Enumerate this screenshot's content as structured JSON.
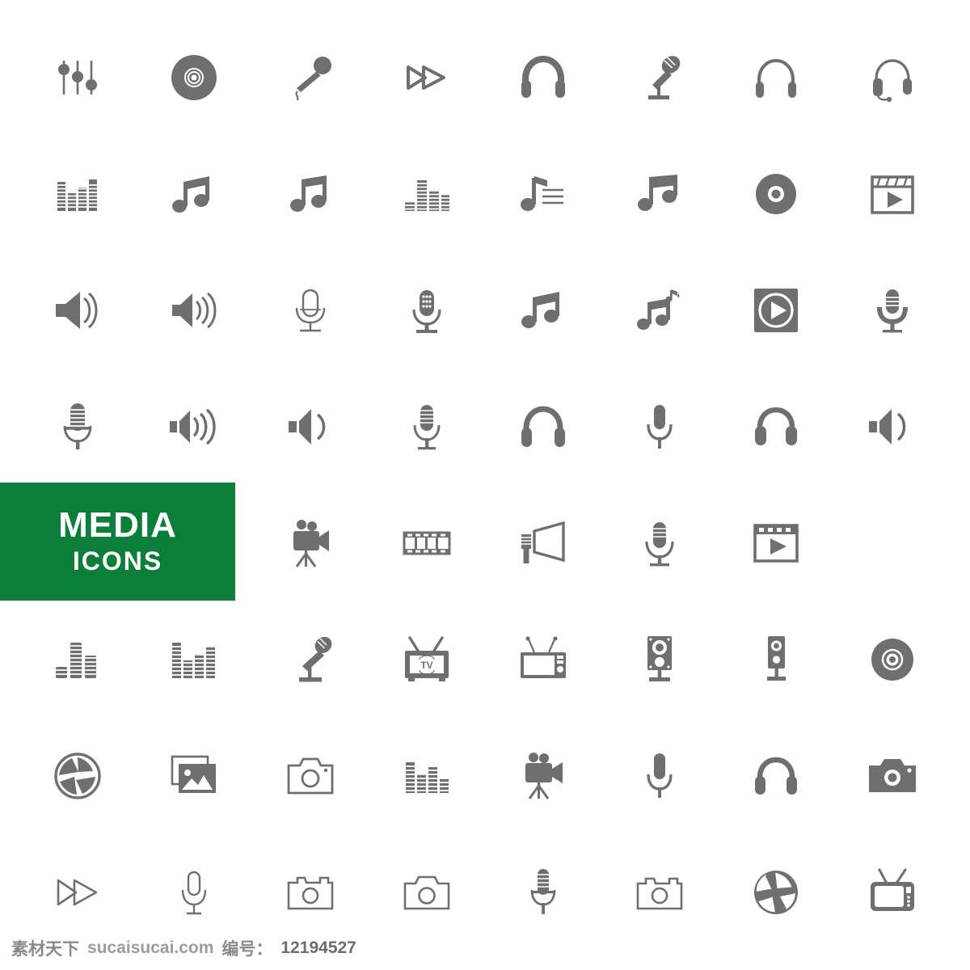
{
  "page": {
    "title": "Media Icons Set",
    "background_color": "#ffffff",
    "icon_color": "#6f6f6f",
    "accent_color": "#0b7e39",
    "columns": 8,
    "rows": 8
  },
  "banner": {
    "line1": "MEDIA",
    "line2": "ICONS",
    "background_color": "#0b7e39",
    "text_color": "#ffffff"
  },
  "footer": {
    "brand": "素材天下",
    "site": "sucaisucai.com",
    "id_label": "编号：",
    "id_value": "12194527"
  },
  "icons": [
    {
      "row": 1,
      "col": 1,
      "name": "equalizer-sliders-icon",
      "label": "Equalizer sliders"
    },
    {
      "row": 1,
      "col": 2,
      "name": "compact-disc-icon",
      "label": "Compact disc"
    },
    {
      "row": 1,
      "col": 3,
      "name": "handheld-microphone-icon",
      "label": "Handheld microphone"
    },
    {
      "row": 1,
      "col": 4,
      "name": "fast-forward-filled-icon",
      "label": "Fast forward"
    },
    {
      "row": 1,
      "col": 5,
      "name": "headphones-filled-icon",
      "label": "Headphones"
    },
    {
      "row": 1,
      "col": 6,
      "name": "studio-microphone-stand-icon",
      "label": "Studio microphone on stand"
    },
    {
      "row": 1,
      "col": 7,
      "name": "headphones-outline-icon",
      "label": "Headphones outline"
    },
    {
      "row": 1,
      "col": 8,
      "name": "headset-with-mic-icon",
      "label": "Headset with microphone"
    },
    {
      "row": 2,
      "col": 1,
      "name": "equalizer-bars-icon",
      "label": "Equalizer bars"
    },
    {
      "row": 2,
      "col": 2,
      "name": "music-note-beamed-icon",
      "label": "Beamed eighth notes"
    },
    {
      "row": 2,
      "col": 3,
      "name": "music-note-beamed-alt-icon",
      "label": "Beamed eighth notes alt"
    },
    {
      "row": 2,
      "col": 4,
      "name": "equalizer-levels-icon",
      "label": "Equalizer levels"
    },
    {
      "row": 2,
      "col": 5,
      "name": "music-playlist-icon",
      "label": "Music note with playlist"
    },
    {
      "row": 2,
      "col": 6,
      "name": "music-note-angled-icon",
      "label": "Angled beamed notes"
    },
    {
      "row": 2,
      "col": 7,
      "name": "disc-solid-icon",
      "label": "Disc"
    },
    {
      "row": 2,
      "col": 8,
      "name": "clapperboard-play-icon",
      "label": "Clapperboard with play"
    },
    {
      "row": 3,
      "col": 1,
      "name": "volume-medium-icon",
      "label": "Volume medium"
    },
    {
      "row": 3,
      "col": 2,
      "name": "volume-high-icon",
      "label": "Volume high"
    },
    {
      "row": 3,
      "col": 3,
      "name": "microphone-outline-stand-icon",
      "label": "Microphone outline on stand"
    },
    {
      "row": 3,
      "col": 4,
      "name": "microphone-grill-stand-icon",
      "label": "Microphone with grill"
    },
    {
      "row": 3,
      "col": 5,
      "name": "music-note-pair-icon",
      "label": "Music notes"
    },
    {
      "row": 3,
      "col": 6,
      "name": "music-notes-extra-icon",
      "label": "Music notes with extra note"
    },
    {
      "row": 3,
      "col": 7,
      "name": "play-button-square-icon",
      "label": "Play button"
    },
    {
      "row": 3,
      "col": 8,
      "name": "vintage-microphone-icon",
      "label": "Vintage microphone"
    },
    {
      "row": 4,
      "col": 1,
      "name": "retro-microphone-icon",
      "label": "Retro microphone"
    },
    {
      "row": 4,
      "col": 2,
      "name": "volume-waves-icon",
      "label": "Volume with waves"
    },
    {
      "row": 4,
      "col": 3,
      "name": "volume-low-icon",
      "label": "Volume low"
    },
    {
      "row": 4,
      "col": 4,
      "name": "condenser-microphone-icon",
      "label": "Condenser microphone"
    },
    {
      "row": 4,
      "col": 5,
      "name": "headphones-thick-icon",
      "label": "Headphones thick"
    },
    {
      "row": 4,
      "col": 6,
      "name": "microphone-slim-icon",
      "label": "Slim microphone"
    },
    {
      "row": 4,
      "col": 7,
      "name": "headphones-round-icon",
      "label": "Round headphones"
    },
    {
      "row": 4,
      "col": 8,
      "name": "volume-single-wave-icon",
      "label": "Volume single wave"
    },
    {
      "row": 5,
      "col": 1,
      "name": "media-icons-banner",
      "label": "MEDIA ICONS banner"
    },
    {
      "row": 5,
      "col": 2,
      "name": "film-strip-icon",
      "label": "Film strip"
    },
    {
      "row": 5,
      "col": 3,
      "name": "movie-camera-tripod-icon",
      "label": "Movie camera on tripod"
    },
    {
      "row": 5,
      "col": 4,
      "name": "film-strip-wide-icon",
      "label": "Film strip wide"
    },
    {
      "row": 5,
      "col": 5,
      "name": "megaphone-icon",
      "label": "Megaphone"
    },
    {
      "row": 5,
      "col": 6,
      "name": "microphone-solid-icon",
      "label": "Microphone"
    },
    {
      "row": 5,
      "col": 7,
      "name": "video-player-icon",
      "label": "Video player"
    },
    {
      "row": 6,
      "col": 1,
      "name": "equalizer-stacked-icon",
      "label": "Stacked equalizer"
    },
    {
      "row": 6,
      "col": 2,
      "name": "equalizer-chart-icon",
      "label": "Equalizer chart"
    },
    {
      "row": 6,
      "col": 3,
      "name": "microphone-desk-stand-icon",
      "label": "Microphone on desk stand"
    },
    {
      "row": 6,
      "col": 4,
      "name": "retro-tv-icon",
      "label": "Retro television"
    },
    {
      "row": 6,
      "col": 5,
      "name": "tv-antenna-icon",
      "label": "Television with antenna"
    },
    {
      "row": 6,
      "col": 6,
      "name": "studio-speaker-icon",
      "label": "Studio speaker"
    },
    {
      "row": 6,
      "col": 7,
      "name": "speaker-tall-icon",
      "label": "Tall speaker"
    },
    {
      "row": 6,
      "col": 8,
      "name": "disc-outline-icon",
      "label": "Disc outline"
    },
    {
      "row": 7,
      "col": 1,
      "name": "aperture-outline-icon",
      "label": "Camera aperture"
    },
    {
      "row": 7,
      "col": 2,
      "name": "photo-gallery-icon",
      "label": "Photo gallery"
    },
    {
      "row": 7,
      "col": 3,
      "name": "camera-outline-icon",
      "label": "Camera outline"
    },
    {
      "row": 7,
      "col": 4,
      "name": "equalizer-small-icon",
      "label": "Small equalizer"
    },
    {
      "row": 7,
      "col": 5,
      "name": "video-camera-tripod-icon",
      "label": "Video camera tripod"
    },
    {
      "row": 7,
      "col": 6,
      "name": "microphone-pill-icon",
      "label": "Pill microphone"
    },
    {
      "row": 7,
      "col": 7,
      "name": "headphones-compact-icon",
      "label": "Compact headphones"
    },
    {
      "row": 7,
      "col": 8,
      "name": "camera-solid-icon",
      "label": "Camera solid"
    },
    {
      "row": 8,
      "col": 1,
      "name": "fast-forward-outline-icon",
      "label": "Fast forward outline"
    },
    {
      "row": 8,
      "col": 2,
      "name": "microphone-line-icon",
      "label": "Microphone line"
    },
    {
      "row": 8,
      "col": 3,
      "name": "camera-line-icon",
      "label": "Camera line"
    },
    {
      "row": 8,
      "col": 4,
      "name": "camera-line-alt-icon",
      "label": "Camera line alt"
    },
    {
      "row": 8,
      "col": 5,
      "name": "vintage-mic-stand-icon",
      "label": "Vintage microphone on stand"
    },
    {
      "row": 8,
      "col": 6,
      "name": "camera-outline-alt-icon",
      "label": "Camera outline alt"
    },
    {
      "row": 8,
      "col": 7,
      "name": "aperture-solid-icon",
      "label": "Aperture solid"
    },
    {
      "row": 8,
      "col": 8,
      "name": "tv-retro-antenna-icon",
      "label": "Retro TV with antenna"
    }
  ]
}
